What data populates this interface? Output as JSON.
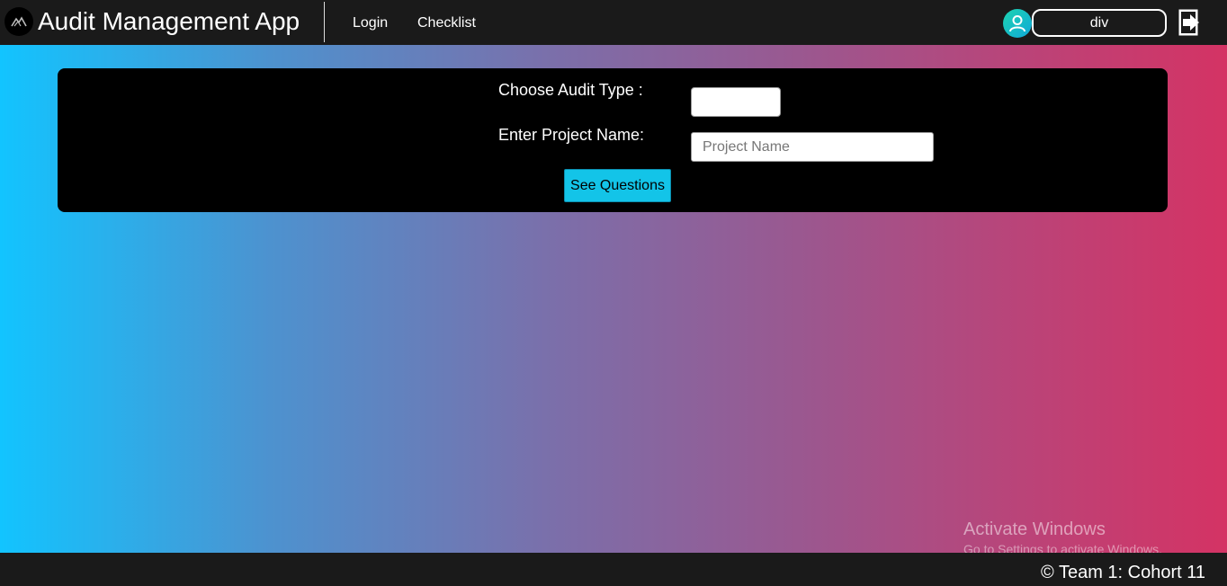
{
  "header": {
    "app_title": "Audit Management App",
    "logo_icon": "mountain-logo-icon",
    "nav": {
      "login_label": "Login",
      "checklist_label": "Checklist"
    },
    "user": {
      "avatar_icon": "user-avatar-icon",
      "username": "div"
    },
    "logout_icon": "logout-icon"
  },
  "form": {
    "audit_type_label": "Choose Audit Type :",
    "audit_type_value": "",
    "project_name_label": "Enter Project Name:",
    "project_name_placeholder": "Project Name",
    "project_name_value": "",
    "submit_label": "See Questions"
  },
  "watermark": {
    "title": "Activate Windows",
    "subtitle": "Go to Settings to activate Windows."
  },
  "footer": {
    "text": "© Team 1: Cohort 11"
  },
  "colors": {
    "nav_bg": "#1a1a1a",
    "panel_bg": "#000000",
    "button_bg": "#13c4e8",
    "gradient_start": "#12c4ff",
    "gradient_end": "#d43364"
  }
}
